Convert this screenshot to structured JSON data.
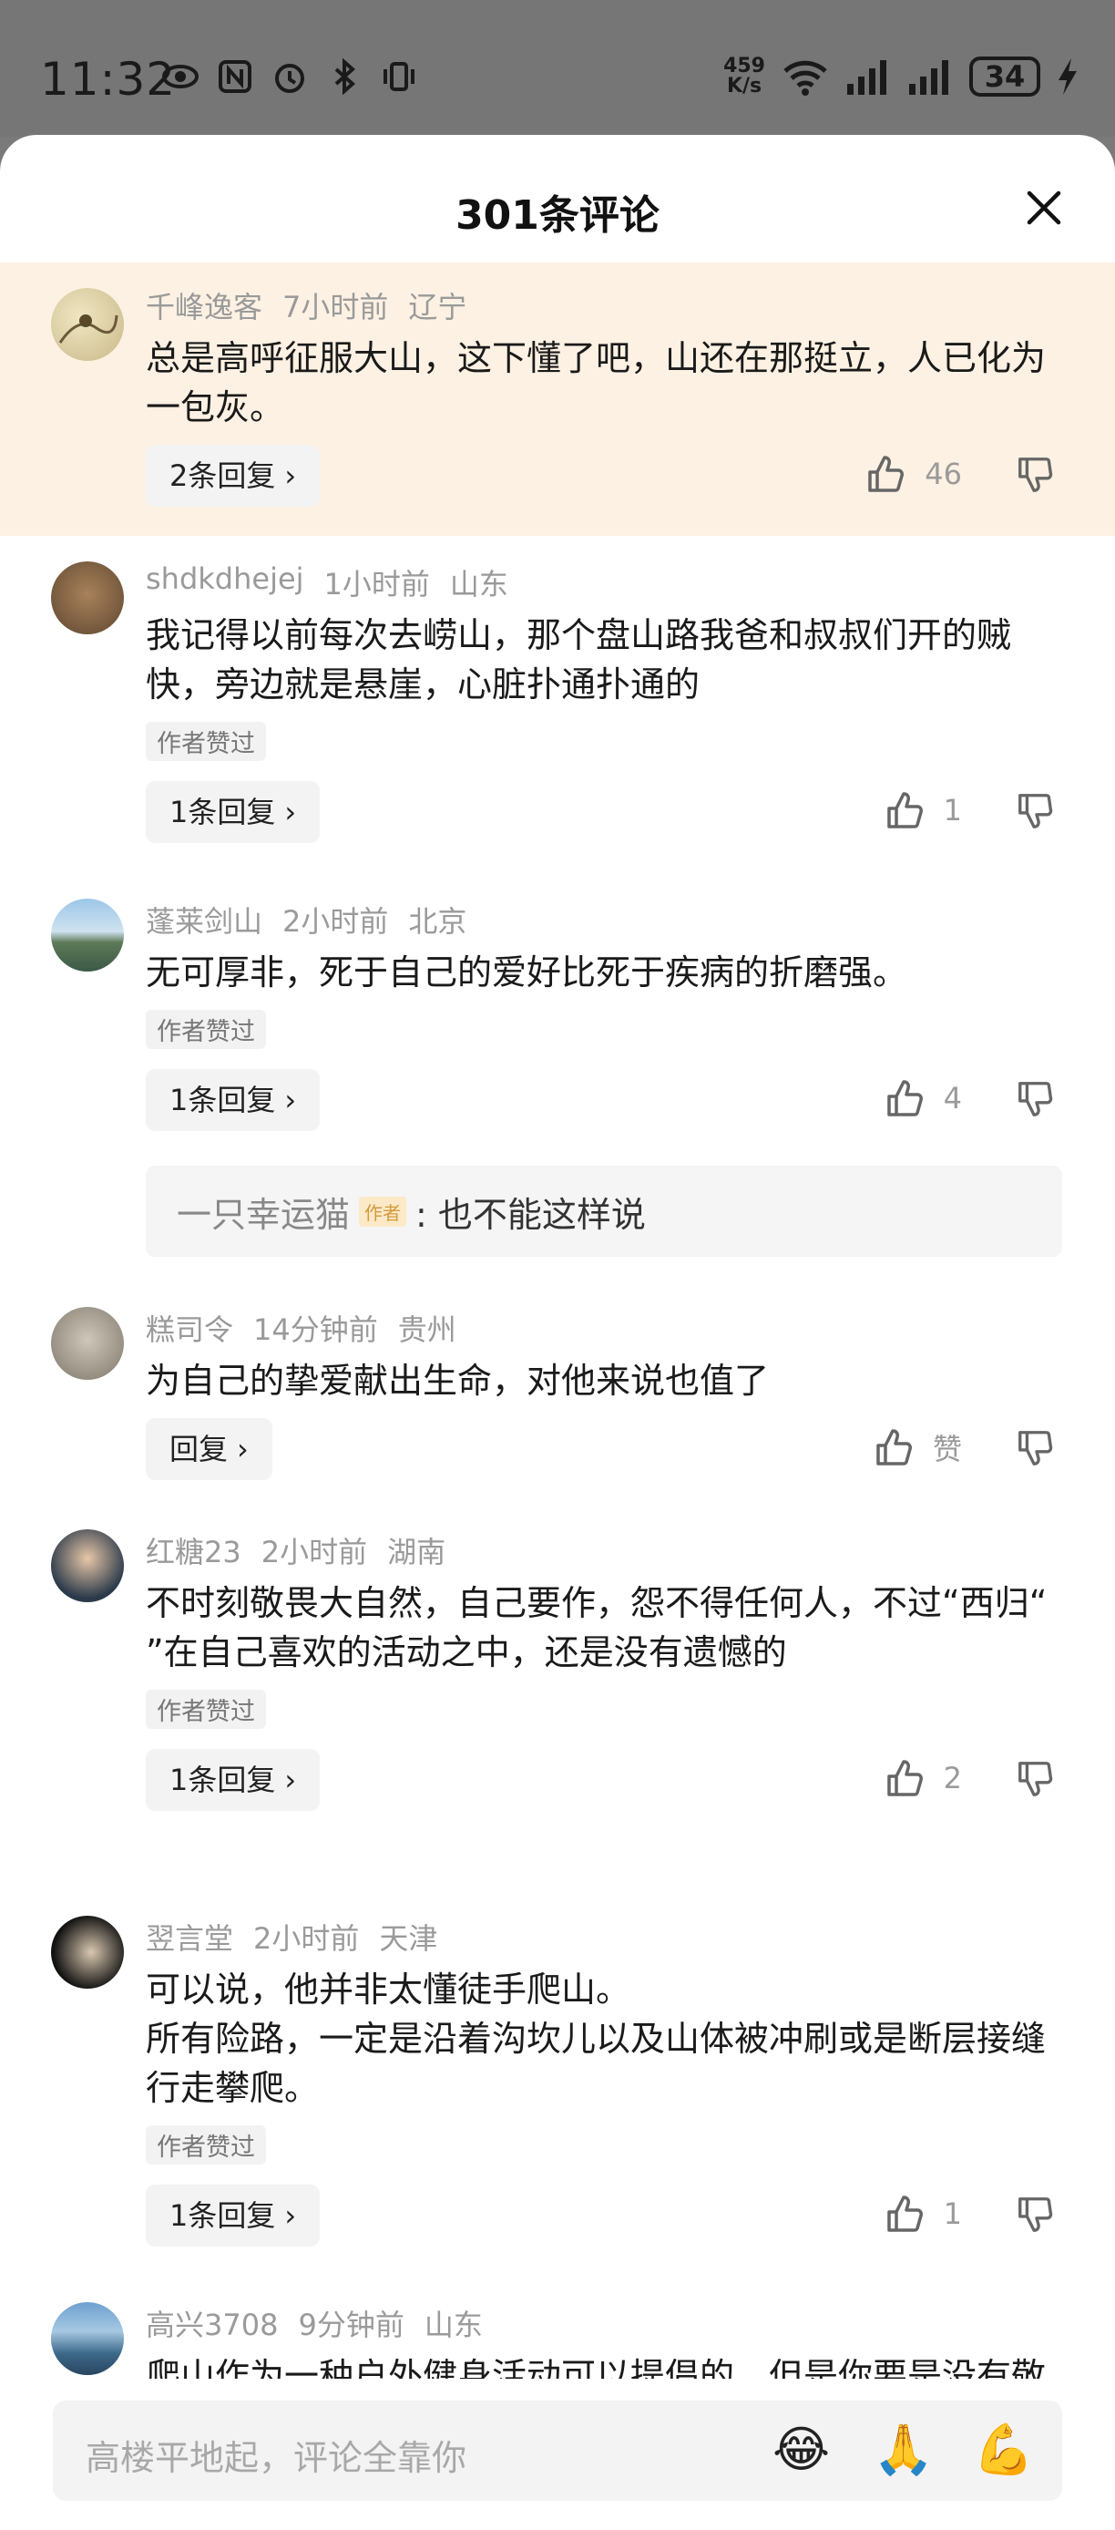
{
  "status_bar": {
    "time": "11:32",
    "net_speed_value": "459",
    "net_speed_unit": "K/s",
    "battery": "34",
    "icons": [
      "eye-icon",
      "nfc-icon",
      "alarm-icon",
      "bluetooth-icon",
      "vibrate-icon",
      "wifi-icon",
      "signal-icon",
      "signal-icon",
      "battery-icon",
      "charging-icon"
    ]
  },
  "sheet": {
    "title": "301条评论",
    "close_icon": "close-icon"
  },
  "comments": [
    {
      "user": "千峰逸客",
      "time": "7小时前",
      "location": "辽宁",
      "text": "总是高呼征服大山，这下懂了吧，山还在那挺立，人已化为一包灰。",
      "reply_label": "2条回复",
      "likes": "46",
      "highlight": true
    },
    {
      "user": "shdkdhejej",
      "time": "1小时前",
      "location": "山东",
      "text": "我记得以前每次去崂山，那个盘山路我爸和叔叔们开的贼快，旁边就是悬崖，心脏扑通扑通的",
      "author_liked": "作者赞过",
      "reply_label": "1条回复",
      "likes": "1"
    },
    {
      "user": "蓬莱剑山",
      "time": "2小时前",
      "location": "北京",
      "text": "无可厚非，死于自己的爱好比死于疾病的折磨强。",
      "author_liked": "作者赞过",
      "reply_label": "1条回复",
      "likes": "4",
      "sub_reply": {
        "user": "一只幸运猫",
        "badge": "作者",
        "text": ": 也不能这样说"
      }
    },
    {
      "user": "糕司令",
      "time": "14分钟前",
      "location": "贵州",
      "text": "为自己的挚爱献出生命，对他来说也值了",
      "reply_label": "回复",
      "likes": "赞"
    },
    {
      "user": "红糖23",
      "time": "2小时前",
      "location": "湖南",
      "text": "不时刻敬畏大自然，自己要作，怨不得任何人，不过“西归“ ”在自己喜欢的活动之中，还是没有遗憾的",
      "author_liked": "作者赞过",
      "reply_label": "1条回复",
      "likes": "2"
    },
    {
      "user": "翌言堂",
      "time": "2小时前",
      "location": "天津",
      "text": "可以说，他并非太懂徒手爬山。\n所有险路，一定是沿着沟坎儿以及山体被冲刷或是断层接缝行走攀爬。",
      "author_liked": "作者赞过",
      "reply_label": "1条回复",
      "likes": "1"
    },
    {
      "user": "高兴3708",
      "time": "9分钟前",
      "location": "山东",
      "text": "爬山作为一种户外健身活动可以提倡的，但是你要是没有敬畏大自然之心，突破了健康健身的目的那就是给自己找"
    }
  ],
  "input": {
    "placeholder": "高楼平地起，评论全靠你",
    "emojis": [
      "😂",
      "🙏",
      "💪"
    ]
  },
  "colors": {
    "highlight_bg": "#fdf1e3",
    "muted_text": "#9a9a9a",
    "author_badge": "#d39a3a"
  }
}
